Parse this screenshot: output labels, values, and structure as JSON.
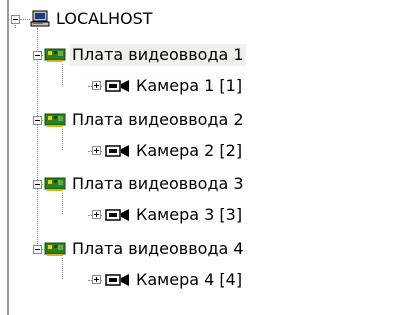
{
  "tree": {
    "root": {
      "label": "LOCALHOST",
      "icon": "computer-icon"
    },
    "boards": [
      {
        "label": "Плата видеоввода 1",
        "icon": "video-capture-card-icon",
        "selected": true,
        "camera": {
          "label": "Камера 1 [1]",
          "icon": "camera-icon"
        }
      },
      {
        "label": "Плата видеоввода 2",
        "icon": "video-capture-card-icon",
        "selected": false,
        "camera": {
          "label": "Камера 2 [2]",
          "icon": "camera-icon"
        }
      },
      {
        "label": "Плата видеоввода 3",
        "icon": "video-capture-card-icon",
        "selected": false,
        "camera": {
          "label": "Камера 3 [3]",
          "icon": "camera-icon"
        }
      },
      {
        "label": "Плата видеоввода 4",
        "icon": "video-capture-card-icon",
        "selected": false,
        "camera": {
          "label": "Камера 4 [4]",
          "icon": "camera-icon"
        }
      }
    ]
  },
  "colors": {
    "board_icon": "#2e7d1e",
    "board_icon_dark": "#114d0a",
    "selection": "#f0f0e8",
    "tree_lines": "#8a8a8a"
  }
}
